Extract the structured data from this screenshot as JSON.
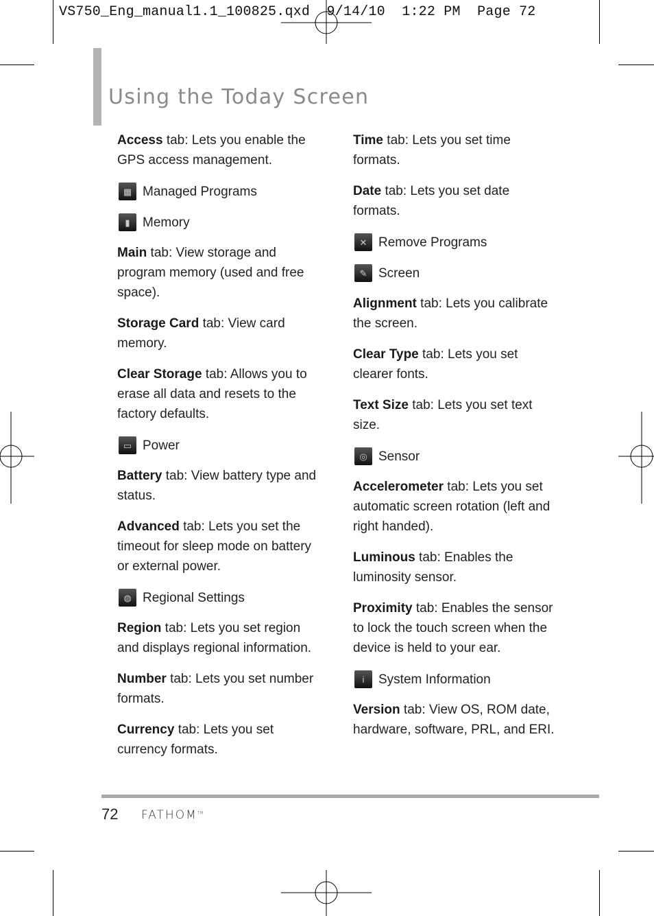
{
  "slug": "VS750_Eng_manual1.1_100825.qxd  9/14/10  1:22 PM  Page 72",
  "page_title": "Using the Today Screen",
  "left_column": [
    {
      "type": "para",
      "bold": "Access",
      "text": " tab: Lets you enable the GPS access management."
    },
    {
      "type": "item",
      "icon": "managed-programs-icon",
      "label": "Managed Programs"
    },
    {
      "type": "item",
      "icon": "memory-icon",
      "label": "Memory"
    },
    {
      "type": "para",
      "bold": "Main",
      "text": " tab: View storage and program memory (used and free space)."
    },
    {
      "type": "para",
      "bold": "Storage Card",
      "text": " tab: View card memory."
    },
    {
      "type": "para",
      "bold": "Clear Storage",
      "text": " tab: Allows you to erase all data and resets to the factory defaults."
    },
    {
      "type": "item",
      "icon": "power-icon",
      "label": "Power"
    },
    {
      "type": "para",
      "bold": "Battery",
      "text": " tab: View battery type and status."
    },
    {
      "type": "para",
      "bold": "Advanced",
      "text": " tab: Lets you set the timeout for sleep mode on battery or external power."
    },
    {
      "type": "item",
      "icon": "regional-settings-icon",
      "label": "Regional Settings"
    },
    {
      "type": "para",
      "bold": "Region",
      "text": " tab: Lets you set region and displays regional information."
    },
    {
      "type": "para",
      "bold": "Number",
      "text": " tab: Lets you set number formats."
    },
    {
      "type": "para",
      "bold": "Currency",
      "text": " tab: Lets you set currency formats."
    }
  ],
  "right_column": [
    {
      "type": "para",
      "bold": "Time",
      "text": " tab: Lets you set time formats."
    },
    {
      "type": "para",
      "bold": "Date",
      "text": " tab: Lets you set date formats."
    },
    {
      "type": "item",
      "icon": "remove-programs-icon",
      "label": "Remove Programs"
    },
    {
      "type": "item",
      "icon": "screen-icon",
      "label": "Screen"
    },
    {
      "type": "para",
      "bold": "Alignment",
      "text": " tab: Lets you calibrate the screen."
    },
    {
      "type": "para",
      "bold": "Clear Type",
      "text": " tab: Lets you set clearer fonts."
    },
    {
      "type": "para",
      "bold": "Text Size",
      "text": " tab: Lets you set text size."
    },
    {
      "type": "item",
      "icon": "sensor-icon",
      "label": "Sensor"
    },
    {
      "type": "para",
      "bold": "Accelerometer",
      "text": " tab: Lets you set automatic screen rotation (left and right handed)."
    },
    {
      "type": "para",
      "bold": "Luminous",
      "text": " tab: Enables the luminosity sensor."
    },
    {
      "type": "para",
      "bold": "Proximity",
      "text": " tab: Enables the sensor to lock the touch screen when the device is held to your ear."
    },
    {
      "type": "item",
      "icon": "system-information-icon",
      "label": "System Information"
    },
    {
      "type": "para",
      "bold": "Version",
      "text": " tab: View OS, ROM date, hardware, software, PRL, and ERI."
    }
  ],
  "footer": {
    "page_number": "72",
    "brand": "FATHOM",
    "trademark": "TM"
  },
  "icon_glyphs": {
    "managed-programs-icon": "▦",
    "memory-icon": "▮",
    "power-icon": "▭",
    "regional-settings-icon": "◍",
    "remove-programs-icon": "✕",
    "screen-icon": "✎",
    "sensor-icon": "◎",
    "system-information-icon": "i"
  }
}
